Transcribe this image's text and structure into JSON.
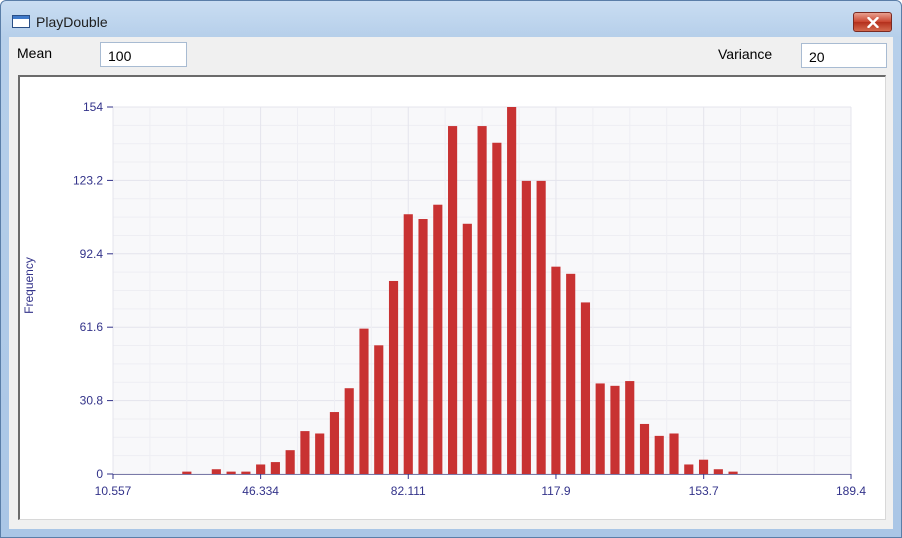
{
  "window": {
    "title": "PlayDouble"
  },
  "controls": {
    "mean_label": "Mean",
    "mean_value": "100",
    "variance_label": "Variance",
    "variance_value": "20"
  },
  "colors": {
    "bar": "#c83232",
    "axis_text": "#33338a",
    "plot_bg": "#f8f8fa",
    "grid": "#e4e4ec"
  },
  "chart_data": {
    "type": "bar",
    "title": "",
    "xlabel": "",
    "ylabel": "Frequency",
    "xlim": [
      10.557,
      189.4
    ],
    "ylim": [
      0,
      154
    ],
    "x_ticks": [
      "10.557",
      "46.334",
      "82.111",
      "117.9",
      "153.7",
      "189.4"
    ],
    "y_ticks": [
      "0",
      "30.8",
      "61.6",
      "92.4",
      "123.2",
      "154"
    ],
    "grid": true,
    "bin_width": 3.5777,
    "series": [
      {
        "x": [
          28.45,
          35.6,
          39.18,
          42.76,
          46.34,
          49.91,
          53.49,
          57.07,
          60.65,
          64.22,
          67.8,
          71.38,
          74.96,
          78.54,
          82.11,
          85.69,
          89.27,
          92.85,
          96.42,
          100.0,
          103.58,
          107.16,
          110.73,
          114.31,
          117.89,
          121.47,
          125.05,
          128.62,
          132.2,
          135.78,
          139.36,
          142.93,
          146.51,
          150.09,
          153.67,
          157.25,
          160.82
        ],
        "values": [
          1,
          2,
          1,
          1,
          4,
          5,
          10,
          18,
          17,
          26,
          36,
          61,
          54,
          81,
          109,
          107,
          113,
          146,
          105,
          146,
          139,
          154,
          123,
          123,
          87,
          84,
          72,
          38,
          37,
          39,
          21,
          16,
          17,
          4,
          6,
          2,
          1
        ]
      }
    ]
  }
}
